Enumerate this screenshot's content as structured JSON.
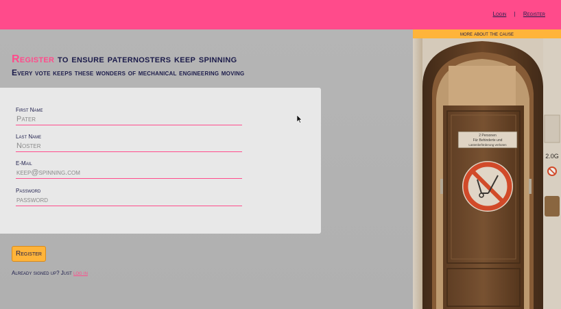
{
  "nav": {
    "login": "Login",
    "separator": "|",
    "register": "Register"
  },
  "headline": {
    "accent": "Register",
    "rest": " to ensure paternosters keep spinning"
  },
  "subheadline": "Every vote keeps these wonders of mechanical engineering moving",
  "form": {
    "first_name": {
      "label": "First Name",
      "placeholder": "Pater"
    },
    "last_name": {
      "label": "Last Name",
      "placeholder": "Noster"
    },
    "email": {
      "label": "E-Mail",
      "placeholder": "keep@spinning.com"
    },
    "password": {
      "label": "Password",
      "placeholder": "password"
    },
    "submit_label": "Register"
  },
  "footer": {
    "prefix": "Already signed up?   Just ",
    "link": "log in"
  },
  "sidebar": {
    "title": "more about the cause",
    "sign_line1": "2 Personen",
    "sign_line2": "Für Behinderte und",
    "sign_line3": "Lastenbeförderung verboten",
    "wall_label": "2.0G"
  },
  "colors": {
    "primary": "#ff4b8b",
    "accent": "#ffb43a",
    "text": "#1b1b4a"
  }
}
